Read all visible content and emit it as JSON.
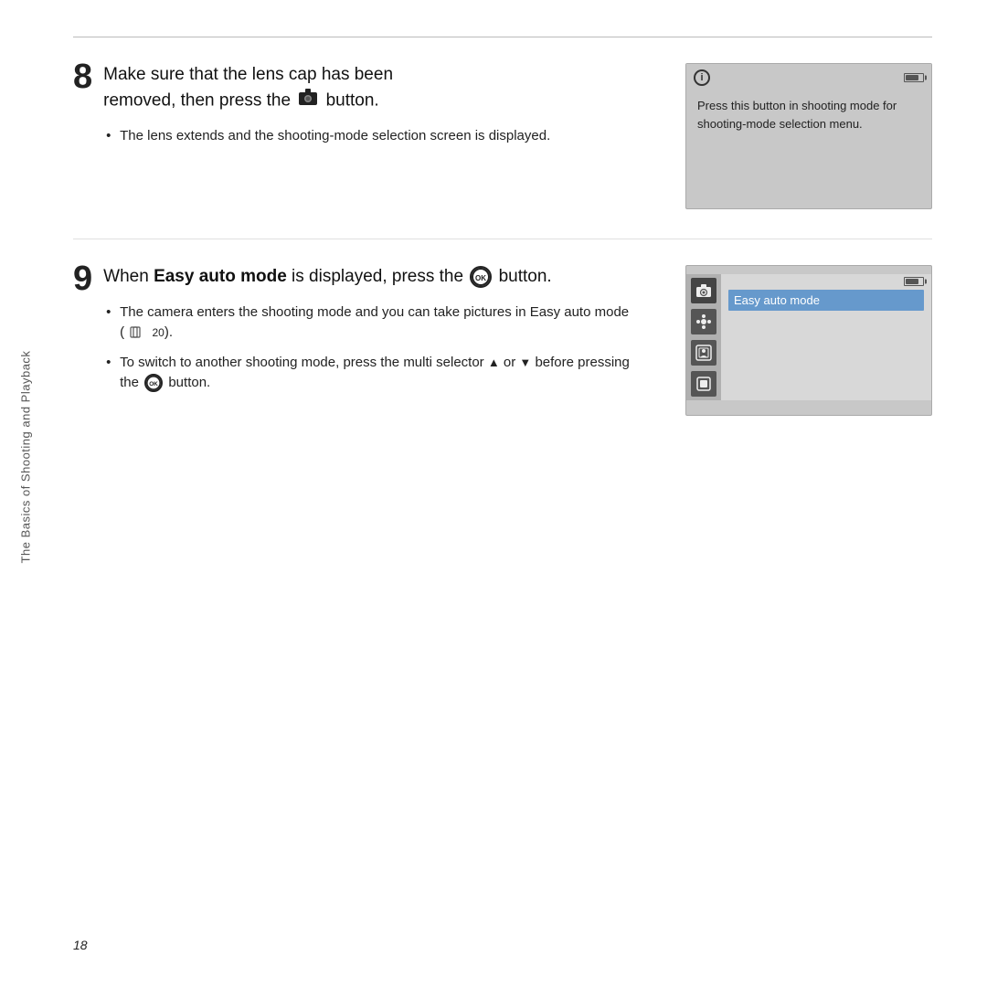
{
  "sidebar": {
    "label": "The Basics of Shooting and Playback"
  },
  "page_number": "18",
  "step8": {
    "number": "8",
    "title_part1": "Make sure that the lens cap has been\nremoved, then press the",
    "title_part2": "button.",
    "bullet1": "The lens extends and the shooting-mode selection screen is displayed.",
    "screen": {
      "info_text": "Press this button in shooting mode for shooting-mode selection menu."
    }
  },
  "step9": {
    "number": "9",
    "title_part1": "When",
    "title_bold": "Easy auto mode",
    "title_part2": "is displayed, press the",
    "title_part3": "button.",
    "bullet1": "The camera enters the shooting mode and you can take pictures in Easy auto mode (",
    "bullet1_ref": "20",
    "bullet1_end": ").",
    "bullet2": "To switch to another shooting mode, press the multi selector",
    "bullet2_up": "▲",
    "bullet2_or": "or",
    "bullet2_down": "▼",
    "bullet2_end": "before pressing the",
    "bullet2_end2": "button.",
    "screen": {
      "easy_auto_label": "Easy auto mode",
      "mode_icons": [
        "📷",
        "✿",
        "🖼",
        "🔲"
      ]
    }
  }
}
